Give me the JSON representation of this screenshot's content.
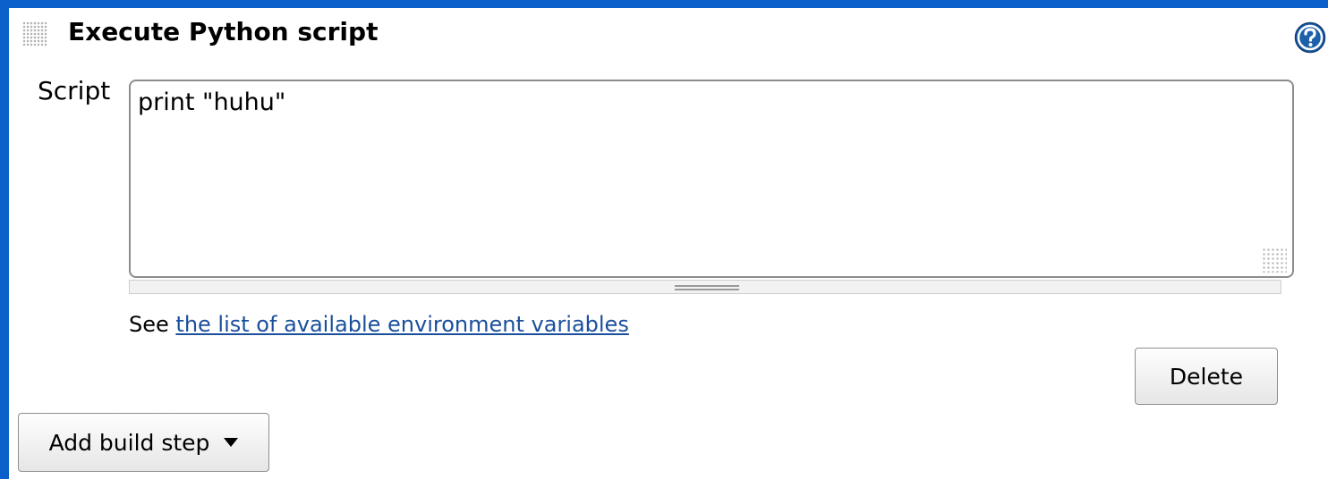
{
  "section": {
    "title": "Execute Python script",
    "help_icon": "question-mark-circle-icon",
    "drag_icon": "drag-handle-icon"
  },
  "script_field": {
    "label": "Script",
    "value": "print \"huhu\""
  },
  "env_hint": {
    "prefix": "See ",
    "link_text": "the list of available environment variables"
  },
  "buttons": {
    "delete_label": "Delete",
    "add_step_label": "Add build step",
    "add_step_icon": "caret-down-icon"
  },
  "colors": {
    "frame": "#0b61c9",
    "link": "#1a4f9c",
    "help_icon": "#1d5fa8"
  }
}
